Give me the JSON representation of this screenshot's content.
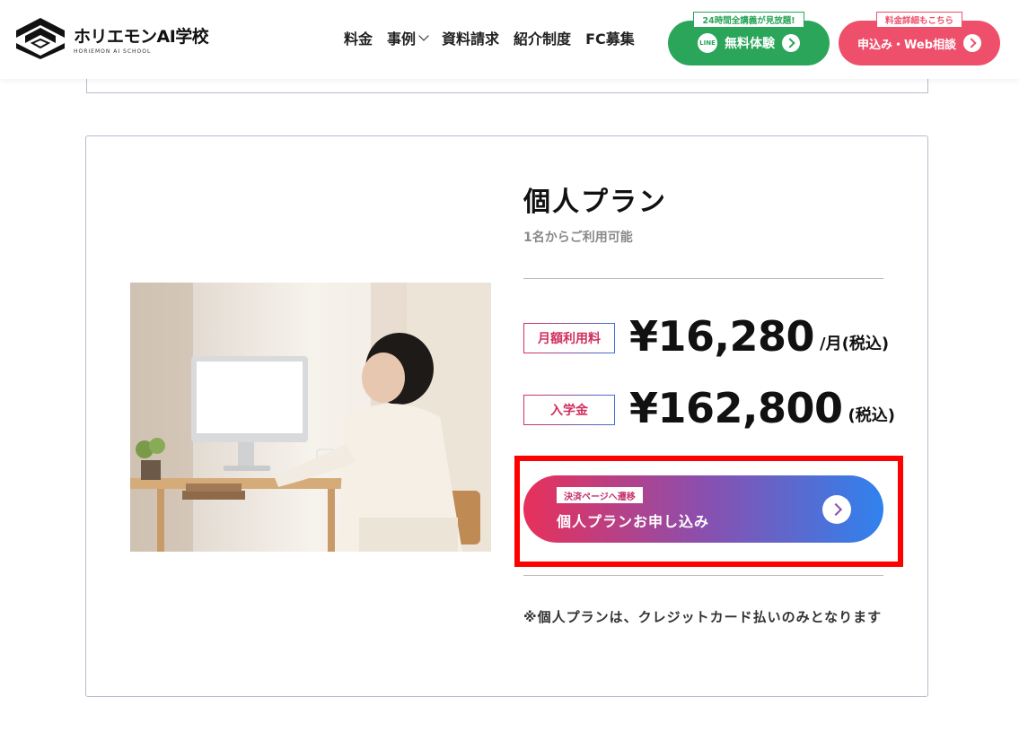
{
  "header": {
    "logo_name": "ホリエモンAI学校",
    "logo_sub": "HORIEMON AI SCHOOL",
    "nav": [
      "料金",
      "事例",
      "資料請求",
      "紹介制度",
      "FC募集"
    ],
    "trial_tag": "24時間全講義が見放題!",
    "trial_label": "無料体験",
    "line_icon_text": "LINE",
    "apply_tag": "料金詳細もこちら",
    "apply_label": "申込み・Web相談"
  },
  "plan": {
    "title": "個人プラン",
    "subtitle": "1名からご利用可能",
    "monthly_label": "月額利用料",
    "monthly_price": "¥16,280",
    "monthly_unit": "/月(税込)",
    "entry_label": "入学金",
    "entry_price": "¥162,800",
    "entry_unit": "(税込)",
    "cta_tag": "決済ページへ遷移",
    "cta_label": "個人プランお申し込み",
    "note": "※個人プランは、クレジットカード払いのみとなります"
  },
  "colors": {
    "accent_green": "#2aa55a",
    "accent_pink": "#ee4f6b",
    "highlight_red": "#ff0000"
  }
}
